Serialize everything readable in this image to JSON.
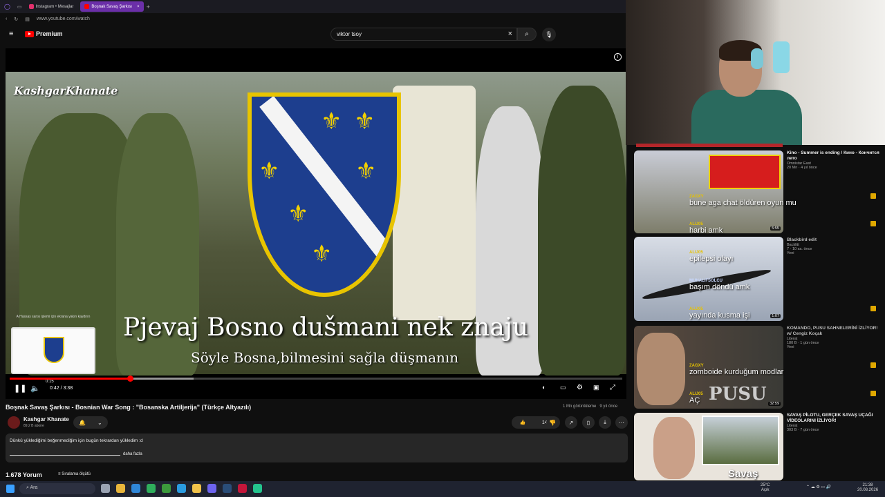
{
  "browser": {
    "tabs": [
      {
        "label": "Instagram • Mesajlar",
        "active": false
      },
      {
        "label": "Boşnak Savaş Şarkısı",
        "active": true
      }
    ],
    "url": "www.youtube.com/watch"
  },
  "youtube": {
    "logo": "Premium",
    "search_value": "viktor tsoy"
  },
  "video": {
    "watermark": "KashgarKhanate",
    "subtitle_line1": "Pjevaj Bosno dušmani nek znaju",
    "subtitle_line2": "Söyle Bosna,bilmesini sağla düşmanın",
    "preview_caption": "A Hassas sansı işlemi için ekrana yakın kaydırın",
    "preview_time": "0:15",
    "timecode": "0:42 / 3:38",
    "progress_fraction": 0.196,
    "title": "Boşnak Savaş Şarkısı - Bosnian War Song : \"Bosanska Artiljerija\" (Türkçe Altyazılı)",
    "views": "1 Mn görüntüleme",
    "age": "9 yıl önce",
    "likes": "14 B"
  },
  "channel": {
    "name": "Kashgar Khanate",
    "subscribers": "89,2 B abone"
  },
  "description": {
    "text": "Dünkü yüklediğimi beğenmediğim için bugün tekrardan yükledim :d",
    "more": "daha fazla"
  },
  "comments": {
    "count": "1.678 Yorum",
    "sort_label": "Sıralama ölçütü"
  },
  "sidebar": {
    "videos": [
      {
        "title": "Kino - Summer is ending / Кино - Кончится лето",
        "channel": "Omnistar East",
        "meta": "20 Mn · 4 yıl önce"
      },
      {
        "title": "Blackbird edit",
        "channel": "Backlitt",
        "meta": "7 · 10 sa. önce",
        "badge": "Yeni"
      },
      {
        "title": "KOMANDO, PUSU SAHNELERİNİ İZLİYOR! w/ Cengiz Koçak",
        "channel": "Literat",
        "meta": "180 B · 1 gün önce",
        "badge": "Yeni"
      },
      {
        "title": "SAVAŞ PİLOTU, GERÇEK SAVAŞ UÇAĞI VİDEOLARINI İZLİYOR!",
        "channel": "Literat",
        "meta": "303 B · 7 gün önce"
      }
    ],
    "durations": [
      "5:55",
      "1:07",
      "32:59"
    ],
    "thumb_texts": [
      "PUSU",
      "Savaş"
    ]
  },
  "chat": [
    {
      "name": "ZAGXY",
      "text": "bune aga chat öldüren oyun mu"
    },
    {
      "name": "ALIJ05",
      "text": "harbi amk"
    },
    {
      "name": "ALIJ05",
      "text": "epilepsi olayı"
    },
    {
      "name": "MUHALIFSOLCU",
      "text": "başım döndü amk"
    },
    {
      "name": "ALIJ05",
      "text": "yayında kusma işi"
    },
    {
      "name": "ZAGXY",
      "text": "zomboide kurduğum modlar"
    },
    {
      "name": "ALIJ05",
      "text": "AÇ"
    }
  ],
  "taskbar": {
    "search": "Ara",
    "weather_temp": "25°C",
    "weather_desc": "Açık",
    "time": "21:38",
    "date": "20.08.2026"
  },
  "colors": {
    "accent": "#ff0000",
    "chat_name": "#e6c200",
    "tab_active": "#6b2fa8"
  }
}
